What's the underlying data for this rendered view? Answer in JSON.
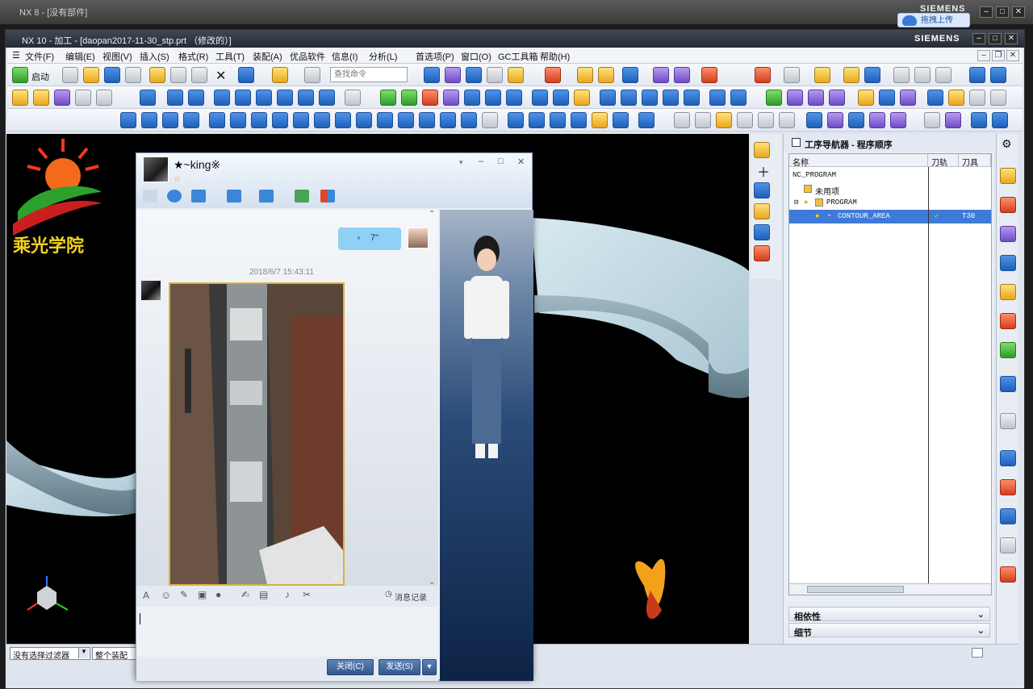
{
  "back_window": {
    "title": "NX 8 - [没有部件]",
    "brand": "SIEMENS",
    "upload_label": "拖拽上传"
  },
  "window": {
    "title": "NX 10 - 加工 - [daopan2017-11-30_stp.prt （修改的）]",
    "brand": "SIEMENS"
  },
  "menu": [
    "文件(F)",
    "编辑(E)",
    "视图(V)",
    "插入(S)",
    "格式(R)",
    "工具(T)",
    "装配(A)",
    "优品软件",
    "信息(I)",
    "分析(L)",
    "首选项(P)",
    "窗口(O)",
    "GC工具箱",
    "帮助(H)"
  ],
  "toolbar": {
    "start_label": "启动",
    "search_placeholder": "查找命令"
  },
  "logo": {
    "text": "乘光学院"
  },
  "navigator": {
    "title": "工序导航器 - 程序顺序",
    "columns": [
      "名称",
      "刀轨",
      "刀具"
    ],
    "rows": [
      {
        "name": "NC_PROGRAM",
        "path": "",
        "tool": ""
      },
      {
        "name": "未用项",
        "path": "",
        "tool": ""
      },
      {
        "name": "PROGRAM",
        "path": "",
        "tool": ""
      },
      {
        "name": "CONTOUR_AREA",
        "path": "✔",
        "tool": "T30"
      }
    ],
    "sections": [
      "相依性",
      "细节"
    ]
  },
  "status": {
    "filter": "没有选择过滤器",
    "assembly": "整个装配"
  },
  "chat": {
    "contact_name": "★~king※",
    "voice_duration": "7\"",
    "timestamp": "2018/6/7 15:43:11",
    "history_label": "消息记录",
    "close_label": "关闭(C)",
    "send_label": "发送(S)"
  },
  "colors": {
    "accent": "#3f7ad8",
    "voice_bubble": "#8fd0f5",
    "viewport_bg": "#000000"
  }
}
